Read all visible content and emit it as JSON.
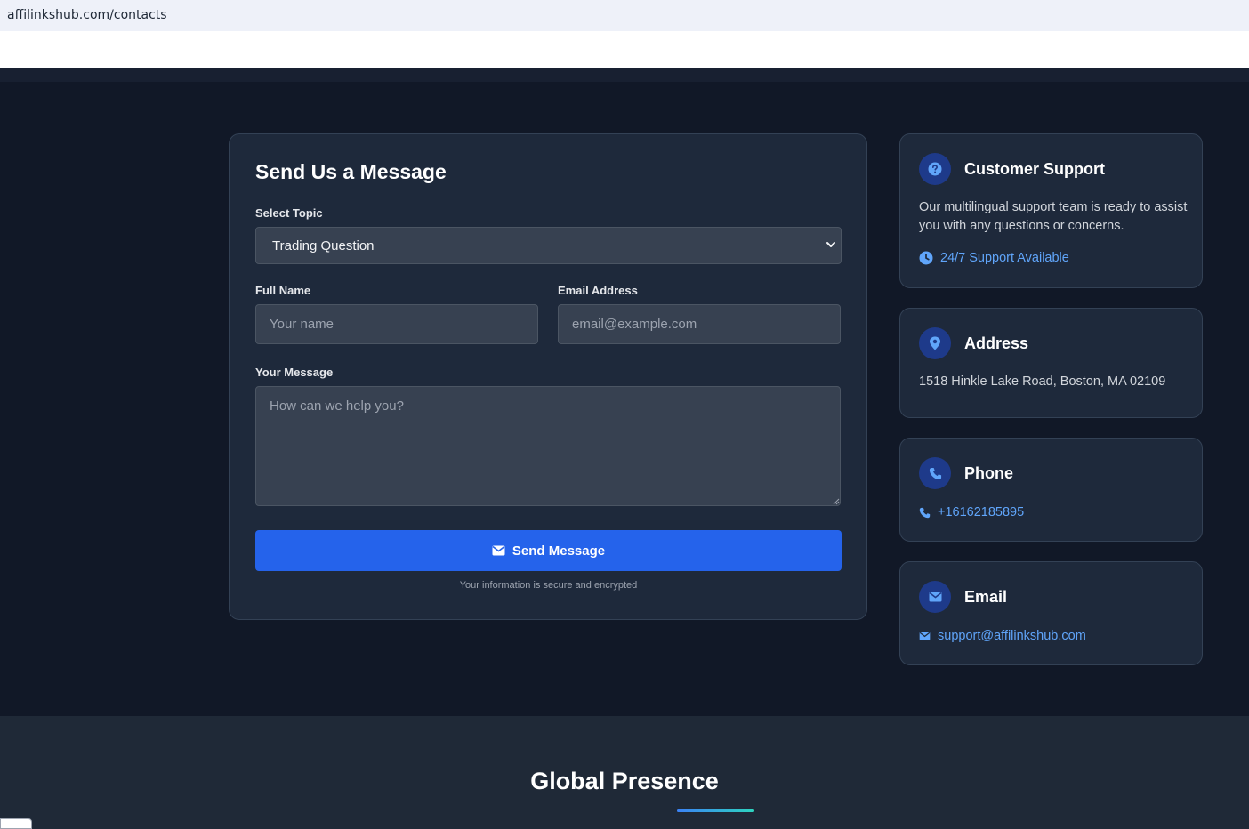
{
  "browser": {
    "url": "affilinkshub.com/contacts"
  },
  "form": {
    "title": "Send Us a Message",
    "topic_label": "Select Topic",
    "topic_value": "Trading Question",
    "name_label": "Full Name",
    "name_placeholder": "Your name",
    "email_label": "Email Address",
    "email_placeholder": "email@example.com",
    "message_label": "Your Message",
    "message_placeholder": "How can we help you?",
    "send_label": "Send Message",
    "secure_note": "Your information is secure and encrypted"
  },
  "support": {
    "title": "Customer Support",
    "text": "Our multilingual support team is ready to assist you with any questions or concerns.",
    "availability": "24/7 Support Available",
    "icon": "question-icon"
  },
  "address": {
    "title": "Address",
    "text": "1518 Hinkle Lake Road, Boston, MA 02109",
    "icon": "map-pin-icon"
  },
  "phone": {
    "title": "Phone",
    "number": "+16162185895",
    "icon": "phone-icon"
  },
  "email": {
    "title": "Email",
    "address": "support@affilinkshub.com",
    "icon": "envelope-icon"
  },
  "global": {
    "title": "Global Presence"
  },
  "colors": {
    "accent": "#2563eb",
    "link": "#60a5fa",
    "card_bg": "#1e293b",
    "page_bg": "#111827"
  }
}
